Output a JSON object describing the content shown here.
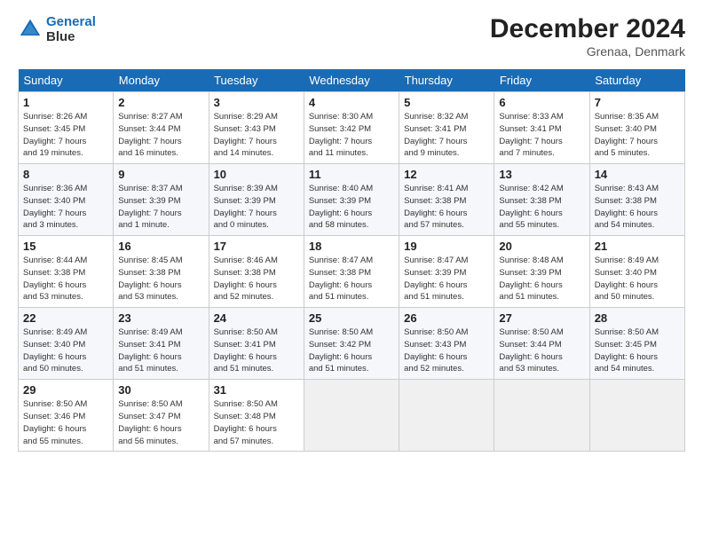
{
  "logo": {
    "line1": "General",
    "line2": "Blue"
  },
  "title": "December 2024",
  "subtitle": "Grenaa, Denmark",
  "days_header": [
    "Sunday",
    "Monday",
    "Tuesday",
    "Wednesday",
    "Thursday",
    "Friday",
    "Saturday"
  ],
  "weeks": [
    [
      {
        "day": "1",
        "info": "Sunrise: 8:26 AM\nSunset: 3:45 PM\nDaylight: 7 hours\nand 19 minutes."
      },
      {
        "day": "2",
        "info": "Sunrise: 8:27 AM\nSunset: 3:44 PM\nDaylight: 7 hours\nand 16 minutes."
      },
      {
        "day": "3",
        "info": "Sunrise: 8:29 AM\nSunset: 3:43 PM\nDaylight: 7 hours\nand 14 minutes."
      },
      {
        "day": "4",
        "info": "Sunrise: 8:30 AM\nSunset: 3:42 PM\nDaylight: 7 hours\nand 11 minutes."
      },
      {
        "day": "5",
        "info": "Sunrise: 8:32 AM\nSunset: 3:41 PM\nDaylight: 7 hours\nand 9 minutes."
      },
      {
        "day": "6",
        "info": "Sunrise: 8:33 AM\nSunset: 3:41 PM\nDaylight: 7 hours\nand 7 minutes."
      },
      {
        "day": "7",
        "info": "Sunrise: 8:35 AM\nSunset: 3:40 PM\nDaylight: 7 hours\nand 5 minutes."
      }
    ],
    [
      {
        "day": "8",
        "info": "Sunrise: 8:36 AM\nSunset: 3:40 PM\nDaylight: 7 hours\nand 3 minutes."
      },
      {
        "day": "9",
        "info": "Sunrise: 8:37 AM\nSunset: 3:39 PM\nDaylight: 7 hours\nand 1 minute."
      },
      {
        "day": "10",
        "info": "Sunrise: 8:39 AM\nSunset: 3:39 PM\nDaylight: 7 hours\nand 0 minutes."
      },
      {
        "day": "11",
        "info": "Sunrise: 8:40 AM\nSunset: 3:39 PM\nDaylight: 6 hours\nand 58 minutes."
      },
      {
        "day": "12",
        "info": "Sunrise: 8:41 AM\nSunset: 3:38 PM\nDaylight: 6 hours\nand 57 minutes."
      },
      {
        "day": "13",
        "info": "Sunrise: 8:42 AM\nSunset: 3:38 PM\nDaylight: 6 hours\nand 55 minutes."
      },
      {
        "day": "14",
        "info": "Sunrise: 8:43 AM\nSunset: 3:38 PM\nDaylight: 6 hours\nand 54 minutes."
      }
    ],
    [
      {
        "day": "15",
        "info": "Sunrise: 8:44 AM\nSunset: 3:38 PM\nDaylight: 6 hours\nand 53 minutes."
      },
      {
        "day": "16",
        "info": "Sunrise: 8:45 AM\nSunset: 3:38 PM\nDaylight: 6 hours\nand 53 minutes."
      },
      {
        "day": "17",
        "info": "Sunrise: 8:46 AM\nSunset: 3:38 PM\nDaylight: 6 hours\nand 52 minutes."
      },
      {
        "day": "18",
        "info": "Sunrise: 8:47 AM\nSunset: 3:38 PM\nDaylight: 6 hours\nand 51 minutes."
      },
      {
        "day": "19",
        "info": "Sunrise: 8:47 AM\nSunset: 3:39 PM\nDaylight: 6 hours\nand 51 minutes."
      },
      {
        "day": "20",
        "info": "Sunrise: 8:48 AM\nSunset: 3:39 PM\nDaylight: 6 hours\nand 51 minutes."
      },
      {
        "day": "21",
        "info": "Sunrise: 8:49 AM\nSunset: 3:40 PM\nDaylight: 6 hours\nand 50 minutes."
      }
    ],
    [
      {
        "day": "22",
        "info": "Sunrise: 8:49 AM\nSunset: 3:40 PM\nDaylight: 6 hours\nand 50 minutes."
      },
      {
        "day": "23",
        "info": "Sunrise: 8:49 AM\nSunset: 3:41 PM\nDaylight: 6 hours\nand 51 minutes."
      },
      {
        "day": "24",
        "info": "Sunrise: 8:50 AM\nSunset: 3:41 PM\nDaylight: 6 hours\nand 51 minutes."
      },
      {
        "day": "25",
        "info": "Sunrise: 8:50 AM\nSunset: 3:42 PM\nDaylight: 6 hours\nand 51 minutes."
      },
      {
        "day": "26",
        "info": "Sunrise: 8:50 AM\nSunset: 3:43 PM\nDaylight: 6 hours\nand 52 minutes."
      },
      {
        "day": "27",
        "info": "Sunrise: 8:50 AM\nSunset: 3:44 PM\nDaylight: 6 hours\nand 53 minutes."
      },
      {
        "day": "28",
        "info": "Sunrise: 8:50 AM\nSunset: 3:45 PM\nDaylight: 6 hours\nand 54 minutes."
      }
    ],
    [
      {
        "day": "29",
        "info": "Sunrise: 8:50 AM\nSunset: 3:46 PM\nDaylight: 6 hours\nand 55 minutes."
      },
      {
        "day": "30",
        "info": "Sunrise: 8:50 AM\nSunset: 3:47 PM\nDaylight: 6 hours\nand 56 minutes."
      },
      {
        "day": "31",
        "info": "Sunrise: 8:50 AM\nSunset: 3:48 PM\nDaylight: 6 hours\nand 57 minutes."
      },
      null,
      null,
      null,
      null
    ]
  ]
}
